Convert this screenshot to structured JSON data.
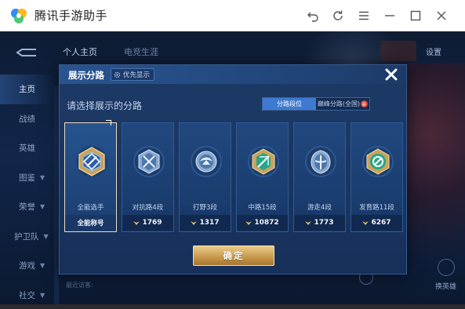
{
  "window": {
    "title": "腾讯手游助手",
    "controls": [
      "undo-icon",
      "refresh-icon",
      "menu-icon",
      "minimize-icon",
      "maximize-icon",
      "close-icon"
    ]
  },
  "game": {
    "top_tabs": [
      {
        "label": "个人主页",
        "active": true
      },
      {
        "label": "电竞生涯",
        "active": false
      }
    ],
    "settings_label": "设置",
    "left_nav": [
      {
        "label": "主页",
        "active": true,
        "arrow": false
      },
      {
        "label": "战绩",
        "active": false,
        "arrow": false
      },
      {
        "label": "英雄",
        "active": false,
        "arrow": false
      },
      {
        "label": "图鉴",
        "active": false,
        "arrow": true
      },
      {
        "label": "荣誉",
        "active": false,
        "arrow": true
      },
      {
        "label": "护卫队",
        "active": false,
        "arrow": true
      },
      {
        "label": "游戏",
        "active": false,
        "arrow": true
      },
      {
        "label": "社交",
        "active": false,
        "arrow": true
      }
    ],
    "bottom_hint": "最近访客:",
    "bottom_right_label": "换英雄"
  },
  "modal": {
    "title": "展示分路",
    "priority_label": "优先显示",
    "prompt": "请选择展示的分路",
    "toggle": {
      "active": "分路段位",
      "inactive": "巅峰分路(全国)",
      "badge": "新"
    },
    "lanes": [
      {
        "name": "全能选手",
        "stat": "全能称号",
        "selected": true,
        "icon": "all-round-emblem-icon"
      },
      {
        "name": "对抗路4段",
        "stat": "1769",
        "selected": false,
        "icon": "clash-lane-emblem-icon"
      },
      {
        "name": "打野3段",
        "stat": "1317",
        "selected": false,
        "icon": "jungle-emblem-icon"
      },
      {
        "name": "中路15段",
        "stat": "10872",
        "selected": false,
        "icon": "mid-lane-emblem-icon"
      },
      {
        "name": "游走4段",
        "stat": "1773",
        "selected": false,
        "icon": "roam-emblem-icon"
      },
      {
        "name": "发育路11段",
        "stat": "6267",
        "selected": false,
        "icon": "farm-lane-emblem-icon"
      }
    ],
    "confirm_label": "确定"
  },
  "colors": {
    "accent_blue": "#3e7ad0",
    "gold": "#c99b4f",
    "modal_bg": "#1a3560"
  }
}
